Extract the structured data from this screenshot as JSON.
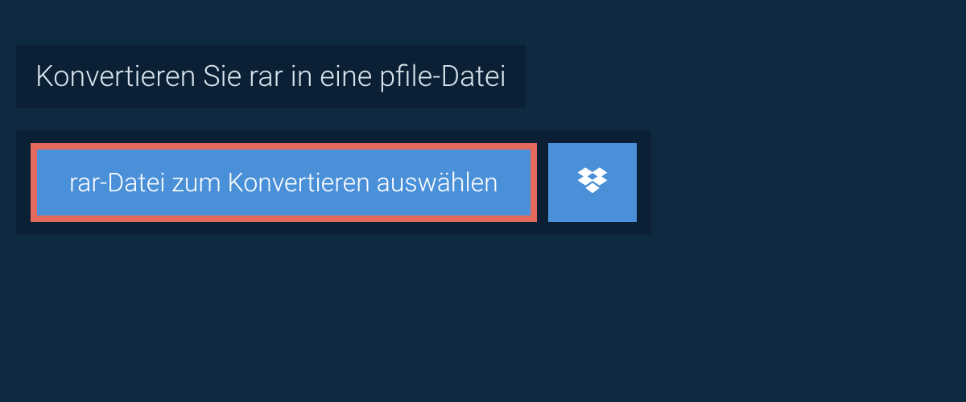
{
  "header": {
    "title": "Konvertieren Sie rar in eine pfile-Datei"
  },
  "actions": {
    "select_file_label": "rar-Datei zum Konvertieren auswählen"
  },
  "colors": {
    "page_bg": "#0f2940",
    "panel_bg": "#0b2034",
    "button_bg": "#4a90d9",
    "highlight_border": "#e46a5e",
    "text_light": "#d8e3ec"
  }
}
